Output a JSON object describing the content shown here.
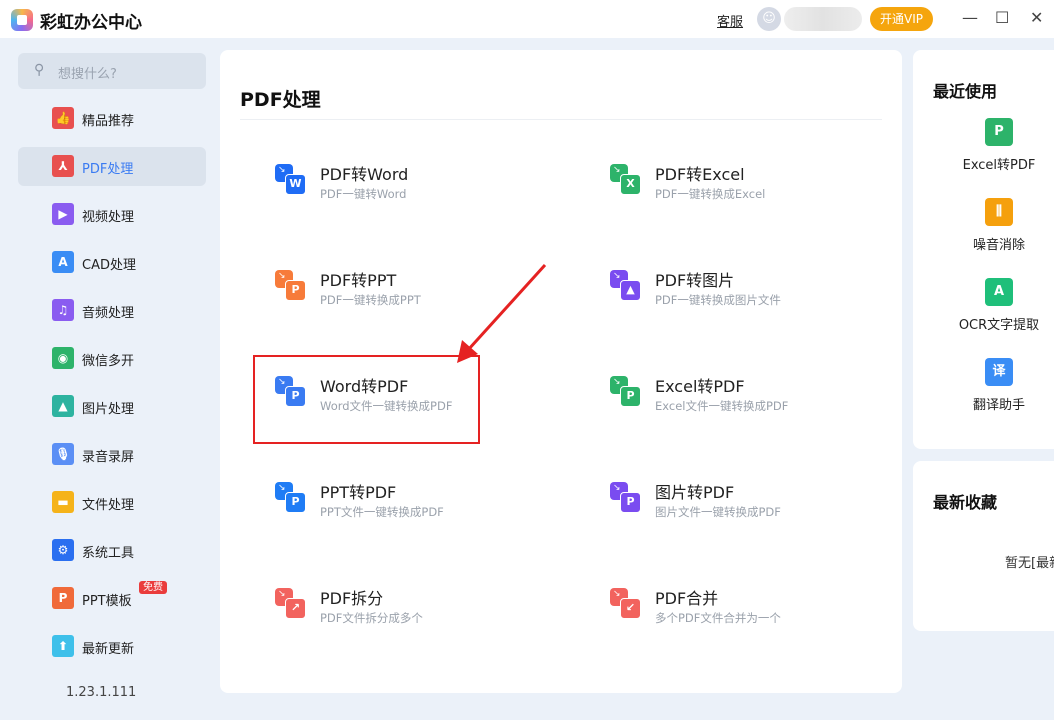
{
  "app": {
    "title": "彩虹办公中心",
    "support": "客服",
    "vip": "开通VIP",
    "minimize": "—",
    "maximize": "☐",
    "close": "✕"
  },
  "sidebar": {
    "search_placeholder": "想搜什么?",
    "items": [
      {
        "label": "精品推荐",
        "color": "#e8504f",
        "glyph": "👍"
      },
      {
        "label": "PDF处理",
        "color": "#e8504f",
        "glyph": "⅄"
      },
      {
        "label": "视频处理",
        "color": "#8a5cf0",
        "glyph": "▶"
      },
      {
        "label": "CAD处理",
        "color": "#3a8df5",
        "glyph": "A"
      },
      {
        "label": "音频处理",
        "color": "#8a5cf0",
        "glyph": "♫"
      },
      {
        "label": "微信多开",
        "color": "#2db36a",
        "glyph": "◉"
      },
      {
        "label": "图片处理",
        "color": "#2db3a0",
        "glyph": "▲"
      },
      {
        "label": "录音录屏",
        "color": "#5b8ff5",
        "glyph": "🎙"
      },
      {
        "label": "文件处理",
        "color": "#f5b31a",
        "glyph": "▬"
      },
      {
        "label": "系统工具",
        "color": "#2a6ff0",
        "glyph": "⚙"
      },
      {
        "label": "PPT模板",
        "color": "#f06a3a",
        "glyph": "P",
        "badge": "免费"
      },
      {
        "label": "最新更新",
        "color": "#3ec0ea",
        "glyph": "⬆"
      }
    ],
    "version": "1.23.1.111"
  },
  "main": {
    "title": "PDF处理",
    "tools": [
      {
        "name": "PDF转Word",
        "desc": "PDF一键转Word",
        "color": "#1f6cf5",
        "letter": "W"
      },
      {
        "name": "PDF转Excel",
        "desc": "PDF一键转换成Excel",
        "color": "#2db36a",
        "letter": "X"
      },
      {
        "name": "PDF转PPT",
        "desc": "PDF一键转换成PPT",
        "color": "#f77b3a",
        "letter": "P"
      },
      {
        "name": "PDF转图片",
        "desc": "PDF一键转换成图片文件",
        "color": "#7a4cf0",
        "letter": "▲"
      },
      {
        "name": "Word转PDF",
        "desc": "Word文件一键转换成PDF",
        "color": "#3a7bf2",
        "letter": "P"
      },
      {
        "name": "Excel转PDF",
        "desc": "Excel文件一键转换成PDF",
        "color": "#2db36a",
        "letter": "P"
      },
      {
        "name": "PPT转PDF",
        "desc": "PPT文件一键转换成PDF",
        "color": "#1f7cf5",
        "letter": "P"
      },
      {
        "name": "图片转PDF",
        "desc": "图片文件一键转换成PDF",
        "color": "#7a4cf0",
        "letter": "P"
      },
      {
        "name": "PDF拆分",
        "desc": "PDF文件拆分成多个",
        "color": "#f2635e",
        "letter": "↗"
      },
      {
        "name": "PDF合并",
        "desc": "多个PDF文件合并为一个",
        "color": "#f2635e",
        "letter": "↙"
      }
    ]
  },
  "recent": {
    "title": "最近使用",
    "items": [
      {
        "label": "Excel转PDF",
        "color": "#2db36a",
        "glyph": "P"
      },
      {
        "label": "噪音消除",
        "color": "#f5a00d",
        "glyph": "⫼"
      },
      {
        "label": "OCR文字提取",
        "color": "#1fbf7a",
        "glyph": "A"
      },
      {
        "label": "翻译助手",
        "color": "#3a8df5",
        "glyph": "译"
      }
    ]
  },
  "favorites": {
    "title": "最新收藏",
    "empty": "暂无[最新收藏]"
  }
}
